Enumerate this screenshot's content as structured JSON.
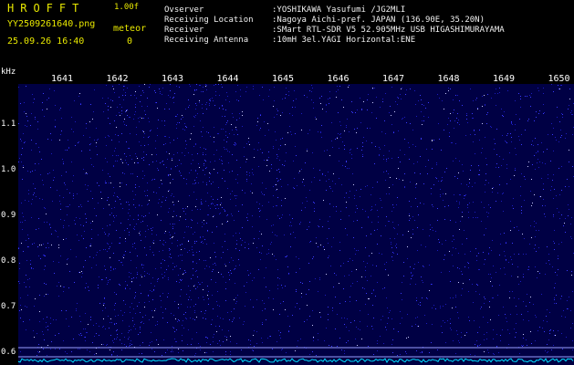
{
  "header": {
    "app_title": "HROFFT",
    "version": "1.00f",
    "file_name": "YY2509261640.png",
    "meteor_label": "meteor",
    "timestamp": "25.09.26 16:40",
    "meteor_count": "0"
  },
  "info": [
    {
      "key": "Ovserver",
      "value": ":YOSHIKAWA Yasufumi /JG2MLI"
    },
    {
      "key": "Receiving Location",
      "value": ":Nagoya Aichi-pref. JAPAN (136.90E, 35.20N)"
    },
    {
      "key": "Receiver",
      "value": ":SMart RTL-SDR V5 52.905MHz USB HIGASHIMURAYAMA"
    },
    {
      "key": "Receiving Antenna",
      "value": ":10mH 3el.YAGI Horizontal:ENE"
    }
  ],
  "chart_data": {
    "type": "heatmap",
    "ylabel": "kHz",
    "x_ticks": [
      "1641",
      "1642",
      "1643",
      "1644",
      "1645",
      "1646",
      "1647",
      "1648",
      "1649",
      "1650"
    ],
    "y_ticks": [
      "1.1",
      "1.0",
      "0.9",
      "0.8",
      "0.7",
      "0.6"
    ],
    "y_tick_values": [
      1.1,
      1.0,
      0.9,
      0.8,
      0.7,
      0.6
    ],
    "ylim": [
      0.574,
      1.19
    ],
    "marker_lines_khz": [
      0.612,
      0.592
    ],
    "colors": {
      "background": "#000044",
      "noise": "#3a3aff",
      "baseline": "#00e0ff",
      "marker": "#9aa0ff"
    }
  }
}
